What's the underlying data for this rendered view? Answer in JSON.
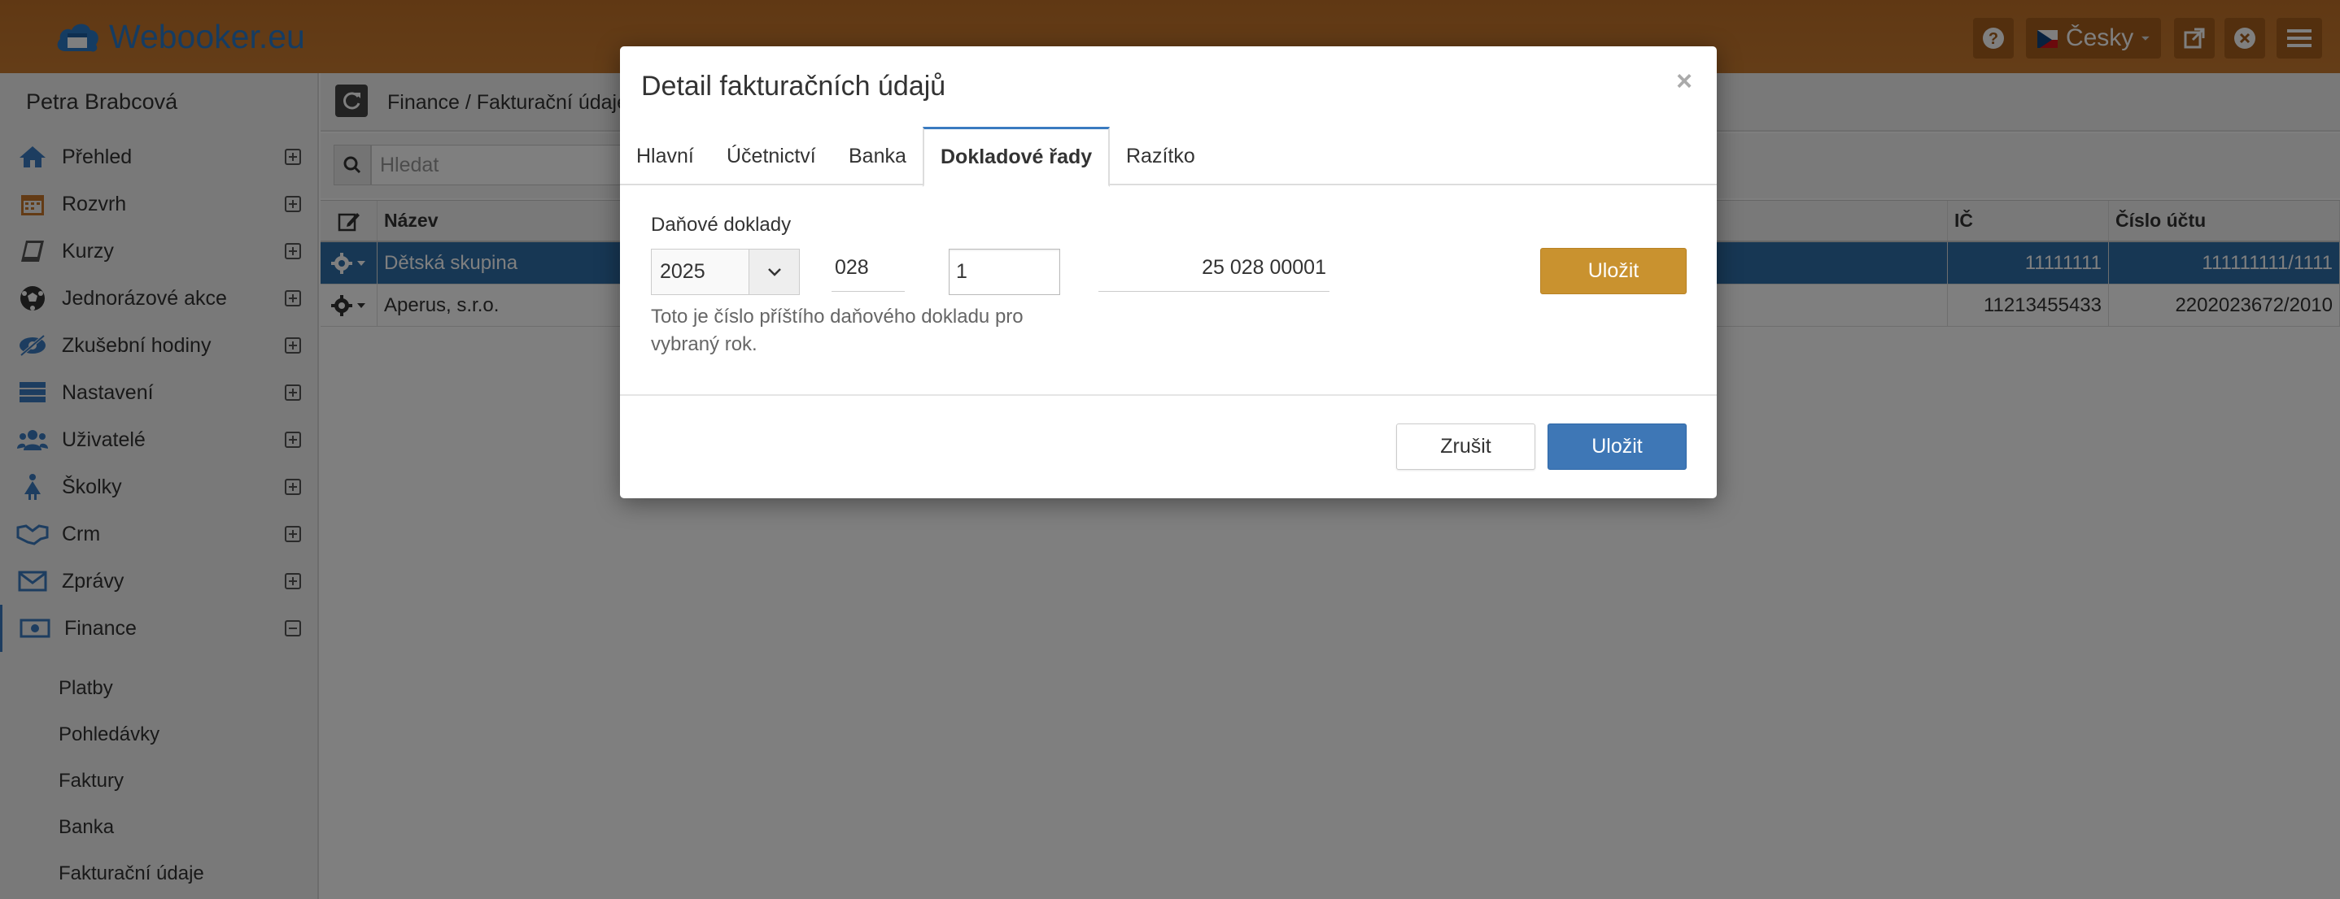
{
  "app": {
    "logo_text": "Webooker.eu",
    "accent": "#c7772a",
    "brand_blue": "#2b78c5"
  },
  "header": {
    "language": "Česky",
    "icons": [
      "question-circle-icon",
      "external-link-icon",
      "close-circle-icon",
      "hamburger-icon"
    ]
  },
  "sidebar": {
    "user_name": "Petra Brabcová",
    "items": [
      {
        "label": "Přehled",
        "icon": "home-icon"
      },
      {
        "label": "Rozvrh",
        "icon": "calendar-icon"
      },
      {
        "label": "Kurzy",
        "icon": "book-icon"
      },
      {
        "label": "Jednorázové akce",
        "icon": "soccer-ball-icon"
      },
      {
        "label": "Zkušební hodiny",
        "icon": "eye-slash-icon"
      },
      {
        "label": "Nastavení",
        "icon": "server-icon"
      },
      {
        "label": "Uživatelé",
        "icon": "users-icon"
      },
      {
        "label": "Školky",
        "icon": "child-icon"
      },
      {
        "label": "Crm",
        "icon": "handshake-icon"
      },
      {
        "label": "Zprávy",
        "icon": "envelope-icon"
      },
      {
        "label": "Finance",
        "icon": "money-icon"
      }
    ],
    "finance_sub": [
      "Platby",
      "Pohledávky",
      "Faktury",
      "Banka",
      "Fakturační údaje"
    ]
  },
  "toolbar": {
    "breadcrumb": "Finance / Fakturační údaje"
  },
  "search": {
    "placeholder": "Hledat"
  },
  "table": {
    "headers": {
      "name": "Název",
      "ic": "IČ",
      "account": "Číslo účtu"
    },
    "rows": [
      {
        "name": "Dětská skupina",
        "ic": "11111111",
        "account": "111111111/1111",
        "selected": true
      },
      {
        "name": "Aperus, s.r.o.",
        "ic": "11213455433",
        "account": "2202023672/2010",
        "selected": false
      }
    ]
  },
  "modal": {
    "title": "Detail fakturačních údajů",
    "close": "×",
    "tabs": [
      "Hlavní",
      "Účetnictví",
      "Banka",
      "Dokladové řady",
      "Razítko"
    ],
    "active_tab": "Dokladové řady",
    "field_label": "Daňové doklady",
    "year": "2025",
    "prefix": "028",
    "number": "1",
    "result": "25 028 00001",
    "help": "Toto je číslo příštího daňového dokladu pro vybraný rok.",
    "save_inline": "Uložit",
    "cancel": "Zrušit",
    "save": "Uložit"
  }
}
